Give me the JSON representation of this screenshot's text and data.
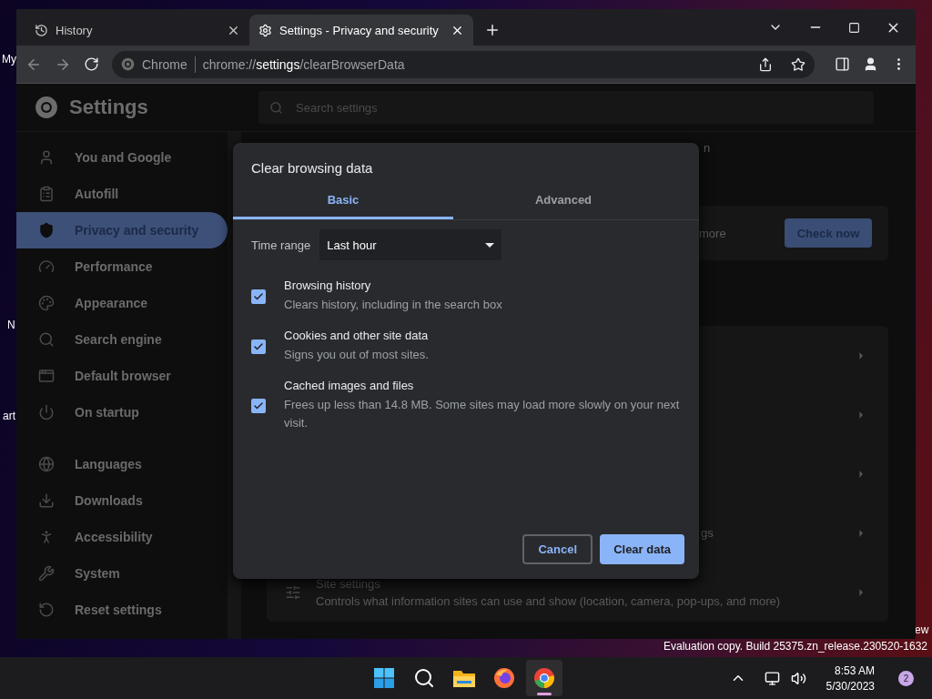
{
  "desktop": {
    "icon_labels": [
      "My",
      "N",
      "art",
      "ew"
    ],
    "watermark": "Evaluation copy. Build 25375.zn_release.230520-1632"
  },
  "browser": {
    "tabs": [
      {
        "title": "History",
        "selected": false
      },
      {
        "title": "Settings - Privacy and security",
        "selected": true
      }
    ],
    "omnibox": {
      "site": "Chrome",
      "url": "chrome://**settings**/clearBrowserData"
    }
  },
  "settings": {
    "title": "Settings",
    "search_placeholder": "Search settings",
    "nav": [
      {
        "label": "You and Google",
        "selected": false
      },
      {
        "label": "Autofill",
        "selected": false
      },
      {
        "label": "Privacy and security",
        "selected": true
      },
      {
        "label": "Performance",
        "selected": false
      },
      {
        "label": "Appearance",
        "selected": false
      },
      {
        "label": "Search engine",
        "selected": false
      },
      {
        "label": "Default browser",
        "selected": false
      },
      {
        "label": "On startup",
        "selected": false
      },
      {
        "label": "Languages",
        "selected": false
      },
      {
        "label": "Downloads",
        "selected": false
      },
      {
        "label": "Accessibility",
        "selected": false
      },
      {
        "label": "System",
        "selected": false
      },
      {
        "label": "Reset settings",
        "selected": false
      }
    ],
    "heading_fragment": "n",
    "safety_fragment": "more",
    "check_button": "Check now",
    "rows": [
      {
        "fragment": ""
      },
      {
        "fragment": ""
      },
      {
        "fragment": ""
      },
      {
        "fragment": "gs"
      },
      {
        "title": "Site settings",
        "description": "Controls what information sites can use and show (location, camera, pop-ups, and more)"
      }
    ]
  },
  "dialog": {
    "title": "Clear browsing data",
    "tabs": [
      {
        "label": "Basic",
        "selected": true
      },
      {
        "label": "Advanced",
        "selected": false
      }
    ],
    "time_range": {
      "label": "Time range",
      "value": "Last hour"
    },
    "options": [
      {
        "title": "Browsing history",
        "description": "Clears history, including in the search box",
        "checked": true
      },
      {
        "title": "Cookies and other site data",
        "description": "Signs you out of most sites.",
        "checked": true
      },
      {
        "title": "Cached images and files",
        "description": "Frees up less than 14.8 MB. Some sites may load more slowly on your next visit.",
        "checked": true
      }
    ],
    "buttons": [
      {
        "label": "Cancel",
        "kind": "secondary"
      },
      {
        "label": "Clear data",
        "kind": "primary"
      }
    ]
  },
  "taskbar": {
    "apps": [
      {
        "active": false
      },
      {
        "active": false
      },
      {
        "active": false
      },
      {
        "active": false
      },
      {
        "active": true
      }
    ],
    "time": "8:53 AM",
    "date": "5/30/2023",
    "notification_count": "2"
  }
}
